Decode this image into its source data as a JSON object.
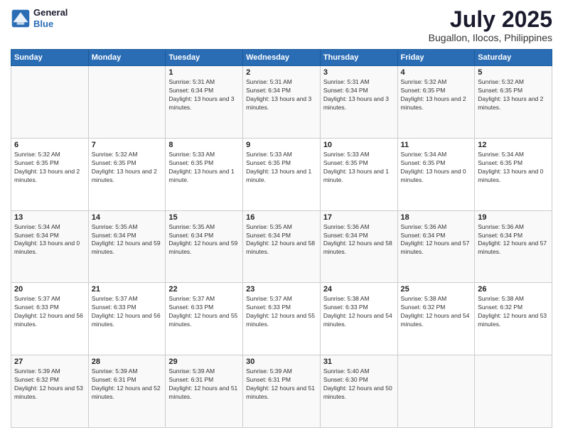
{
  "header": {
    "logo_line1": "General",
    "logo_line2": "Blue",
    "title": "July 2025",
    "subtitle": "Bugallon, Ilocos, Philippines"
  },
  "weekdays": [
    "Sunday",
    "Monday",
    "Tuesday",
    "Wednesday",
    "Thursday",
    "Friday",
    "Saturday"
  ],
  "weeks": [
    [
      {
        "day": "",
        "info": ""
      },
      {
        "day": "",
        "info": ""
      },
      {
        "day": "1",
        "info": "Sunrise: 5:31 AM\nSunset: 6:34 PM\nDaylight: 13 hours and 3 minutes."
      },
      {
        "day": "2",
        "info": "Sunrise: 5:31 AM\nSunset: 6:34 PM\nDaylight: 13 hours and 3 minutes."
      },
      {
        "day": "3",
        "info": "Sunrise: 5:31 AM\nSunset: 6:34 PM\nDaylight: 13 hours and 3 minutes."
      },
      {
        "day": "4",
        "info": "Sunrise: 5:32 AM\nSunset: 6:35 PM\nDaylight: 13 hours and 2 minutes."
      },
      {
        "day": "5",
        "info": "Sunrise: 5:32 AM\nSunset: 6:35 PM\nDaylight: 13 hours and 2 minutes."
      }
    ],
    [
      {
        "day": "6",
        "info": "Sunrise: 5:32 AM\nSunset: 6:35 PM\nDaylight: 13 hours and 2 minutes."
      },
      {
        "day": "7",
        "info": "Sunrise: 5:32 AM\nSunset: 6:35 PM\nDaylight: 13 hours and 2 minutes."
      },
      {
        "day": "8",
        "info": "Sunrise: 5:33 AM\nSunset: 6:35 PM\nDaylight: 13 hours and 1 minute."
      },
      {
        "day": "9",
        "info": "Sunrise: 5:33 AM\nSunset: 6:35 PM\nDaylight: 13 hours and 1 minute."
      },
      {
        "day": "10",
        "info": "Sunrise: 5:33 AM\nSunset: 6:35 PM\nDaylight: 13 hours and 1 minute."
      },
      {
        "day": "11",
        "info": "Sunrise: 5:34 AM\nSunset: 6:35 PM\nDaylight: 13 hours and 0 minutes."
      },
      {
        "day": "12",
        "info": "Sunrise: 5:34 AM\nSunset: 6:35 PM\nDaylight: 13 hours and 0 minutes."
      }
    ],
    [
      {
        "day": "13",
        "info": "Sunrise: 5:34 AM\nSunset: 6:34 PM\nDaylight: 13 hours and 0 minutes."
      },
      {
        "day": "14",
        "info": "Sunrise: 5:35 AM\nSunset: 6:34 PM\nDaylight: 12 hours and 59 minutes."
      },
      {
        "day": "15",
        "info": "Sunrise: 5:35 AM\nSunset: 6:34 PM\nDaylight: 12 hours and 59 minutes."
      },
      {
        "day": "16",
        "info": "Sunrise: 5:35 AM\nSunset: 6:34 PM\nDaylight: 12 hours and 58 minutes."
      },
      {
        "day": "17",
        "info": "Sunrise: 5:36 AM\nSunset: 6:34 PM\nDaylight: 12 hours and 58 minutes."
      },
      {
        "day": "18",
        "info": "Sunrise: 5:36 AM\nSunset: 6:34 PM\nDaylight: 12 hours and 57 minutes."
      },
      {
        "day": "19",
        "info": "Sunrise: 5:36 AM\nSunset: 6:34 PM\nDaylight: 12 hours and 57 minutes."
      }
    ],
    [
      {
        "day": "20",
        "info": "Sunrise: 5:37 AM\nSunset: 6:33 PM\nDaylight: 12 hours and 56 minutes."
      },
      {
        "day": "21",
        "info": "Sunrise: 5:37 AM\nSunset: 6:33 PM\nDaylight: 12 hours and 56 minutes."
      },
      {
        "day": "22",
        "info": "Sunrise: 5:37 AM\nSunset: 6:33 PM\nDaylight: 12 hours and 55 minutes."
      },
      {
        "day": "23",
        "info": "Sunrise: 5:37 AM\nSunset: 6:33 PM\nDaylight: 12 hours and 55 minutes."
      },
      {
        "day": "24",
        "info": "Sunrise: 5:38 AM\nSunset: 6:33 PM\nDaylight: 12 hours and 54 minutes."
      },
      {
        "day": "25",
        "info": "Sunrise: 5:38 AM\nSunset: 6:32 PM\nDaylight: 12 hours and 54 minutes."
      },
      {
        "day": "26",
        "info": "Sunrise: 5:38 AM\nSunset: 6:32 PM\nDaylight: 12 hours and 53 minutes."
      }
    ],
    [
      {
        "day": "27",
        "info": "Sunrise: 5:39 AM\nSunset: 6:32 PM\nDaylight: 12 hours and 53 minutes."
      },
      {
        "day": "28",
        "info": "Sunrise: 5:39 AM\nSunset: 6:31 PM\nDaylight: 12 hours and 52 minutes."
      },
      {
        "day": "29",
        "info": "Sunrise: 5:39 AM\nSunset: 6:31 PM\nDaylight: 12 hours and 51 minutes."
      },
      {
        "day": "30",
        "info": "Sunrise: 5:39 AM\nSunset: 6:31 PM\nDaylight: 12 hours and 51 minutes."
      },
      {
        "day": "31",
        "info": "Sunrise: 5:40 AM\nSunset: 6:30 PM\nDaylight: 12 hours and 50 minutes."
      },
      {
        "day": "",
        "info": ""
      },
      {
        "day": "",
        "info": ""
      }
    ]
  ]
}
